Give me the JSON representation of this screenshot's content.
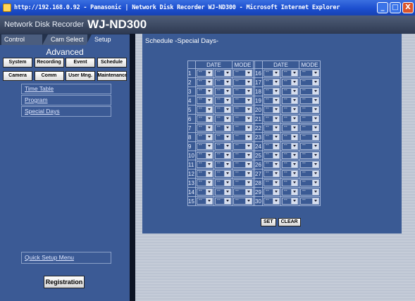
{
  "window": {
    "title": "http://192.168.0.92 - Panasonic | Network Disk Recorder WJ-ND300 - Microsoft Internet Explorer",
    "buttons": [
      "_",
      "□",
      "X"
    ]
  },
  "header": {
    "subtitle": "Network Disk Recorder",
    "model": "WJ-ND300"
  },
  "tabs": [
    "Control",
    "Cam Select",
    "Setup"
  ],
  "sidebar": {
    "section_title": "Advanced",
    "buttons": [
      "System",
      "Recording",
      "Event",
      "Schedule",
      "Camera",
      "Comm",
      "User Mng.",
      "Maintenance"
    ],
    "submenu": [
      "Time Table",
      "Program",
      "Special Days"
    ],
    "quick_setup": "Quick Setup Menu",
    "registration": "Registration"
  },
  "panel": {
    "title": "Schedule -Special Days-",
    "headers": {
      "date": "DATE",
      "mode": "MODE"
    },
    "empty_value": "--",
    "rows_left": [
      "1",
      "2",
      "3",
      "4",
      "5",
      "6",
      "7",
      "8",
      "9",
      "10",
      "11",
      "12",
      "13",
      "14",
      "15"
    ],
    "rows_right": [
      "16",
      "17",
      "18",
      "19",
      "20",
      "21",
      "22",
      "23",
      "24",
      "25",
      "26",
      "27",
      "28",
      "29",
      "30"
    ],
    "set_label": "SET",
    "clear_label": "CLEAR"
  }
}
